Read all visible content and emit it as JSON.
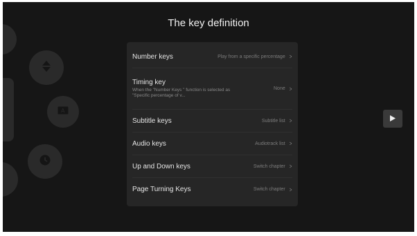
{
  "header": {
    "title": "The key definition"
  },
  "settings": {
    "rows": [
      {
        "label": "Number keys",
        "value": "Play from a specific percentage"
      },
      {
        "label": "Timing key",
        "description": "When the \"Number Keys \" function is selected as \"Specific percentage of v...",
        "value": "None"
      },
      {
        "label": "Subtitle keys",
        "value": "Subtitle list"
      },
      {
        "label": "Audio keys",
        "value": "Audiotrack list"
      },
      {
        "label": "Up and Down keys",
        "value": "Switch chapter"
      },
      {
        "label": "Page Turning Keys",
        "value": "Switch chapter"
      }
    ]
  },
  "icons": {
    "play": "play-icon",
    "chevron": "chevron-right-icon",
    "remote_buttons": [
      "up-down-arrows-icon",
      "subtitle-icon",
      "clock-icon"
    ]
  },
  "colors": {
    "background": "#161616",
    "panel": "#262626",
    "text_primary": "#e6e6e6",
    "text_secondary": "#7c7c7c"
  }
}
